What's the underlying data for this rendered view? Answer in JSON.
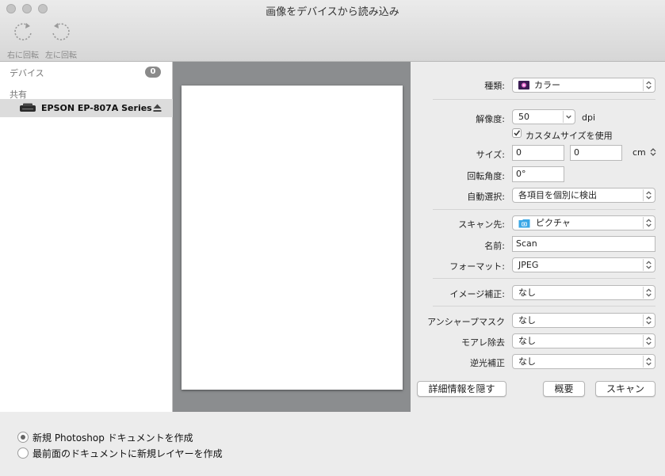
{
  "window": {
    "title": "画像をデバイスから読み込み"
  },
  "toolbar": {
    "rotate_right": "右に回転",
    "rotate_left": "左に回転"
  },
  "sidebar": {
    "devices_header": "デバイス",
    "devices_count": "0",
    "shared_header": "共有",
    "device_name": "EPSON EP-807A Series"
  },
  "settings": {
    "kind_label": "種類:",
    "kind_value": "カラー",
    "resolution_label": "解像度:",
    "resolution_value": "50",
    "resolution_unit": "dpi",
    "custom_size_label": "カスタムサイズを使用",
    "custom_size_checked": true,
    "size_label": "サイズ:",
    "size_width": "0",
    "size_height": "0",
    "size_unit": "cm",
    "rotation_label": "回転角度:",
    "rotation_value": "0°",
    "auto_select_label": "自動選択:",
    "auto_select_value": "各項目を個別に検出",
    "scan_to_label": "スキャン先:",
    "scan_to_value": "ピクチャ",
    "name_label": "名前:",
    "name_value": "Scan",
    "format_label": "フォーマット:",
    "format_value": "JPEG",
    "image_correction_label": "イメージ補正:",
    "image_correction_value": "なし",
    "unsharp_label": "アンシャープマスク",
    "unsharp_value": "なし",
    "moire_label": "モアレ除去",
    "moire_value": "なし",
    "backlight_label": "逆光補正",
    "backlight_value": "なし"
  },
  "actions": {
    "hide_details": "詳細情報を隠す",
    "overview": "概要",
    "scan": "スキャン"
  },
  "options": {
    "new_document": "新規 Photoshop ドキュメントを作成",
    "new_layer": "最前面のドキュメントに新規レイヤーを作成",
    "selected": "new_document"
  },
  "colors": {
    "preview_bg": "#8b8d8f",
    "folder_icon": "#3aa7e6"
  }
}
